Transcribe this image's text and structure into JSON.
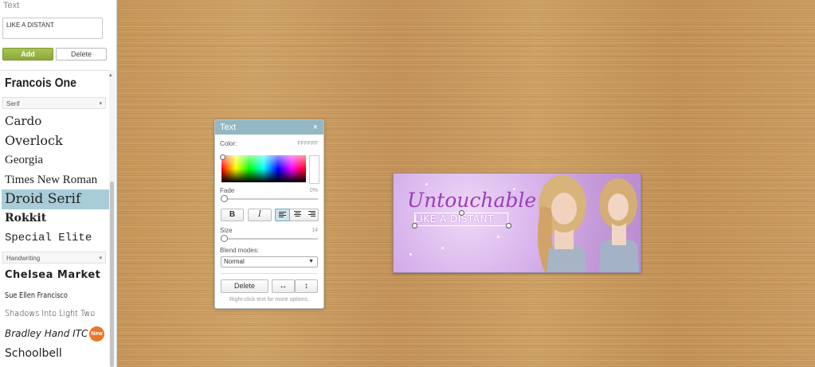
{
  "sidebar": {
    "section_title": "Text",
    "text_value": "LIKE A DISTANT",
    "add_label": "Add",
    "delete_label": "Delete",
    "fonts_top": [
      "Francois One"
    ],
    "category_serif": "Serif",
    "serif_fonts": [
      "Cardo",
      "Overlock",
      "Georgia",
      "Times New Roman",
      "Droid Serif",
      "Rokkit",
      "Special Elite"
    ],
    "selected_font": "Droid Serif",
    "category_handwriting": "Handwriting",
    "handwriting_fonts": [
      "Chelsea Market",
      "Sue Ellen Francisco",
      "Shadows Into Light Two",
      "Bradley Hand ITC",
      "Schoolbell"
    ],
    "new_badge": "New"
  },
  "panel": {
    "title": "Text",
    "close": "×",
    "color_label": "Color:",
    "color_value": "FFFFFF",
    "fade_label": "Fade",
    "fade_value": "0%",
    "fade_level": 0,
    "bold_label": "B",
    "italic_label": "I",
    "align_active": "left",
    "size_label": "Size",
    "size_value": "14",
    "blend_label": "Blend modes:",
    "blend_value": "Normal",
    "delete_label": "Delete",
    "flip_h_icon": "↔",
    "flip_v_icon": "↕",
    "hint": "Right-click text for more options."
  },
  "banner": {
    "title": "Untouchable",
    "subtitle": "LIKE A DISTANT"
  },
  "colors": {
    "accent": "#93b8c3",
    "add_button": "#9bb849",
    "selected_font_bg": "#a8cdd8",
    "banner_title": "#9a3fb3"
  }
}
